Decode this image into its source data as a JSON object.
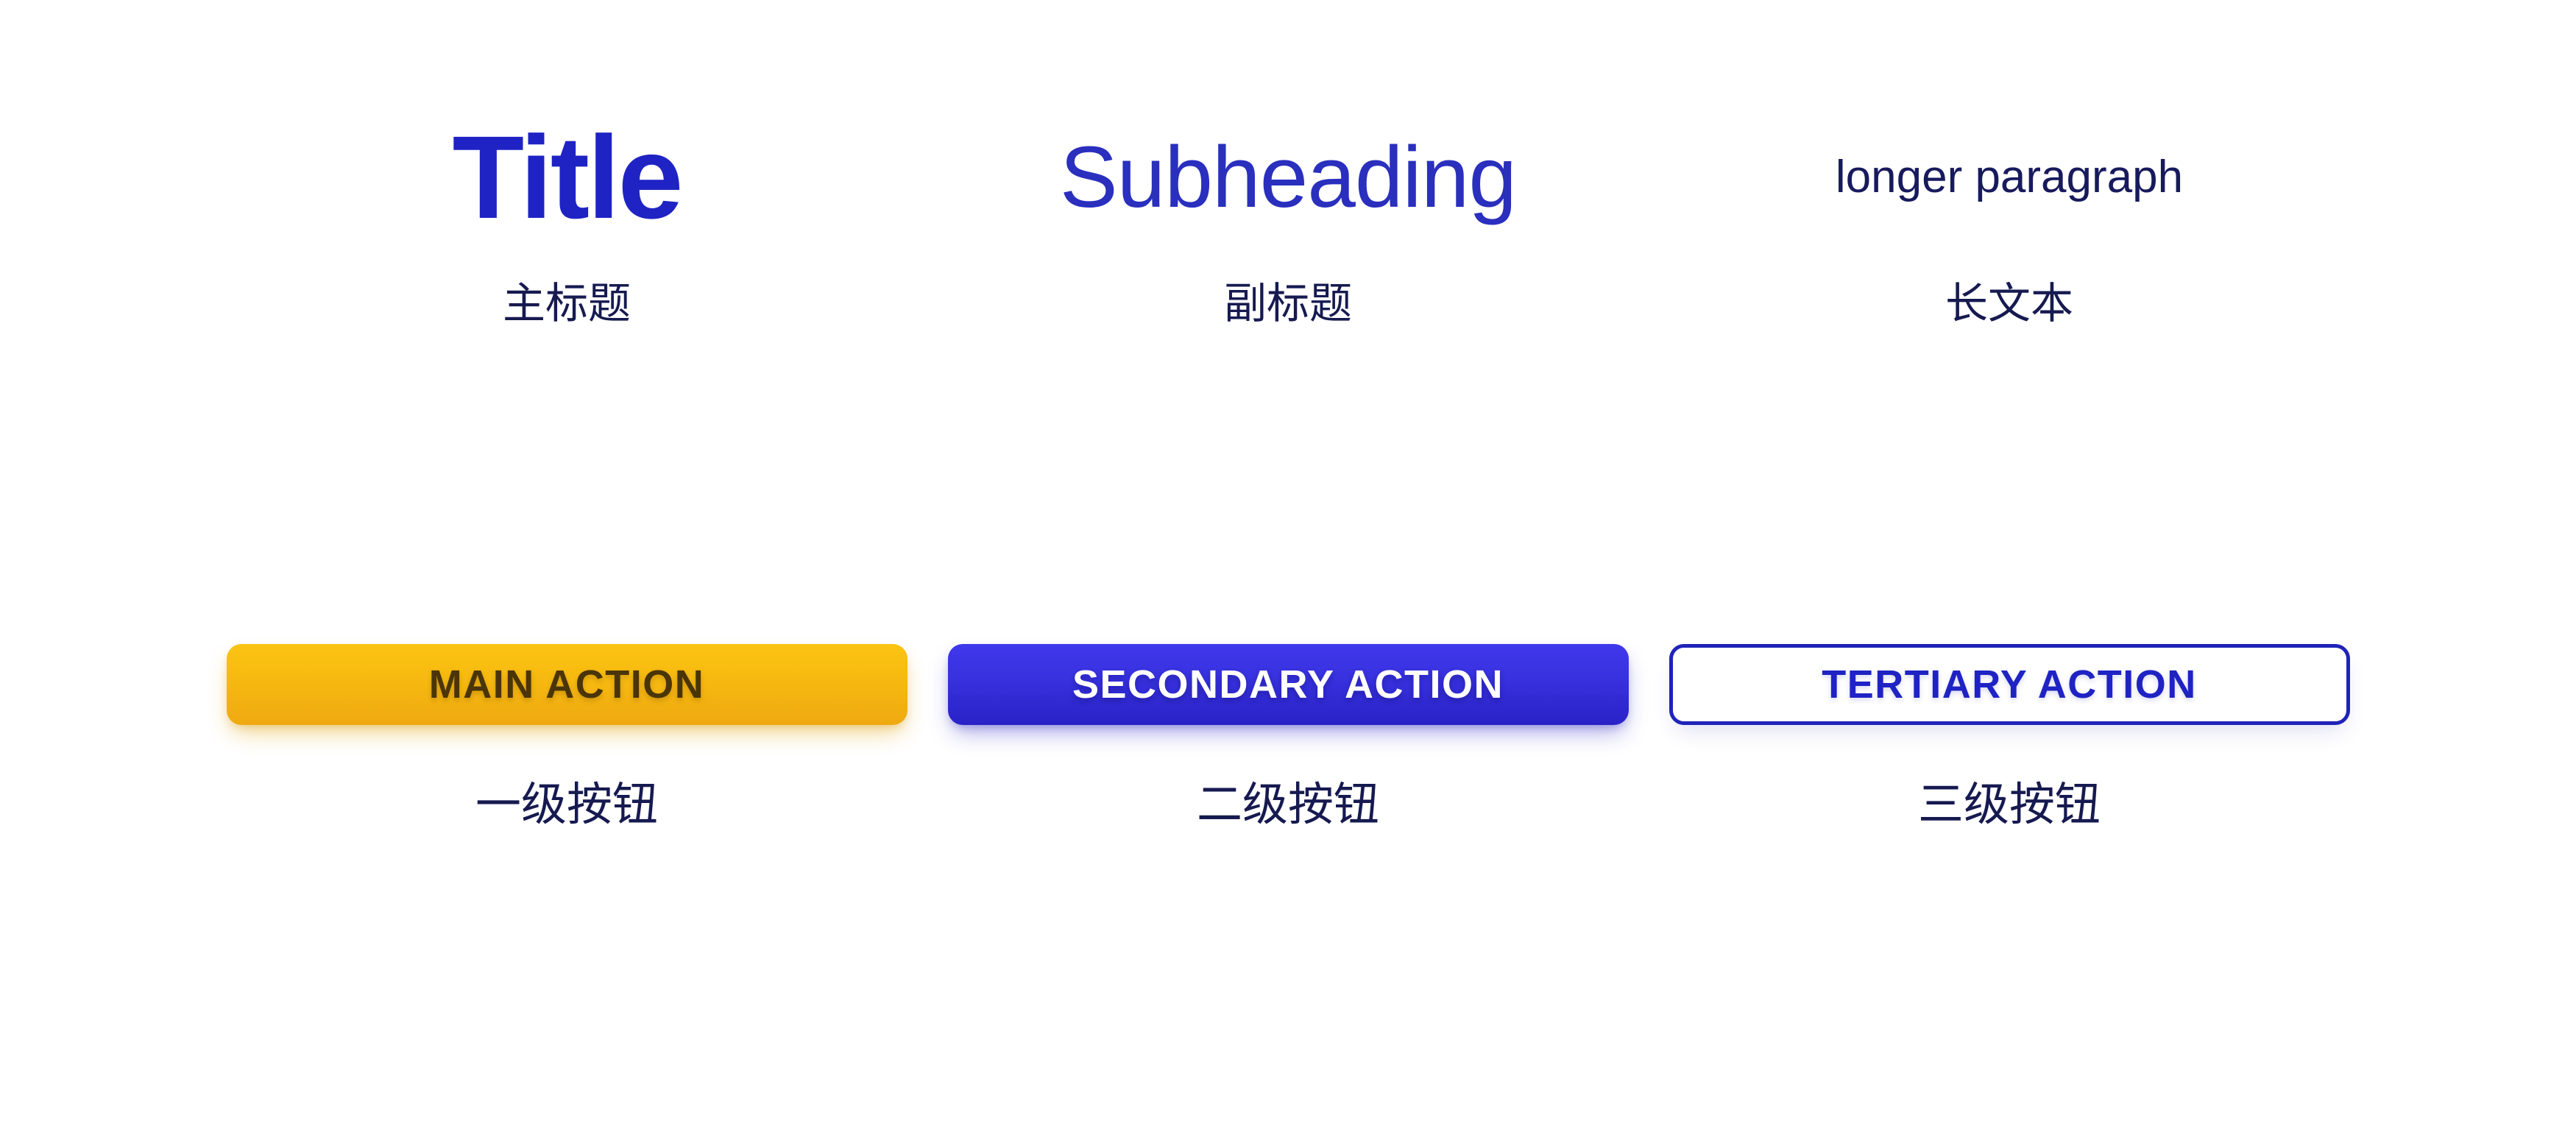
{
  "page": {
    "background_color": "#ffffff",
    "brand_blue": "#1f23c4",
    "navy": "#161a50",
    "accent_yellow": "#f7bb10"
  },
  "typography": {
    "samples": [
      {
        "id": "title",
        "sample_text": "Title",
        "caption": "主标题",
        "color": "#1f23c4"
      },
      {
        "id": "subheading",
        "sample_text": "Subheading",
        "caption": "副标题",
        "color": "#2a2fbe"
      },
      {
        "id": "paragraph",
        "sample_text": "longer paragraph",
        "caption": "长文本",
        "color": "#171a5c"
      }
    ]
  },
  "buttons": {
    "items": [
      {
        "id": "primary",
        "label": "MAIN ACTION",
        "caption": "一级按钮",
        "fill": "#f7bb10",
        "text_color": "#4a3508"
      },
      {
        "id": "secondary",
        "label": "SECONDARY ACTION",
        "caption": "二级按钮",
        "fill": "#3832e0",
        "text_color": "#ffffff"
      },
      {
        "id": "tertiary",
        "label": "TERTIARY ACTION",
        "caption": "三级按钮",
        "fill": "#ffffff",
        "text_color": "#1f23c4",
        "border_color": "#1f23b9"
      }
    ]
  }
}
